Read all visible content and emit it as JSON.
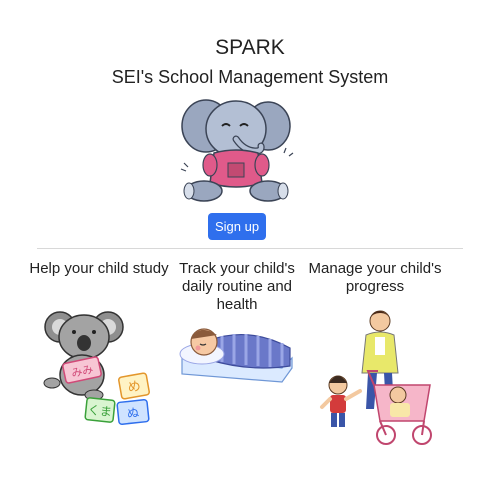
{
  "header": {
    "title": "SPARK",
    "subtitle": "SEI's School Management System"
  },
  "hero": {
    "icon": "elephant-mascot-icon"
  },
  "signup": {
    "label": "Sign up"
  },
  "features": [
    {
      "title": "Help your child study",
      "icon": "koala-with-cards-icon"
    },
    {
      "title": "Track your child's daily routine and health",
      "icon": "sleeping-baby-icon"
    },
    {
      "title": "Manage your child's progress",
      "icon": "mother-stroller-icon"
    }
  ],
  "cards": [
    "め",
    "くま",
    "ぬ",
    "みみ"
  ],
  "colors": {
    "accent": "#2f6fed",
    "elephant": "#9aa7bf",
    "jacket": "#e05a8a"
  }
}
